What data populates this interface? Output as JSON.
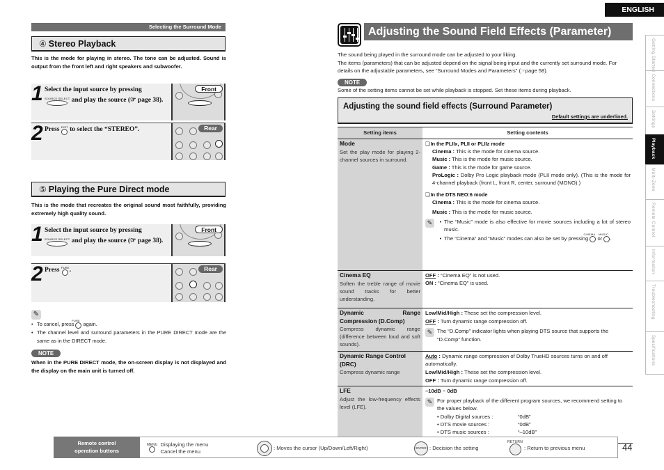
{
  "left_page": {
    "section_header": "Selecting the Surround Mode",
    "stereo": {
      "number": "④",
      "title": "Stereo Playback",
      "intro": "This is the mode for playing in stereo. The tone can be adjusted. Sound is output from the front left and right speakers and subwoofer.",
      "step1": {
        "num": "1",
        "text_a": "Select the input source by pressing",
        "button_label": "SOURCE SELECT",
        "text_b": "and play the source (",
        "page_ref_icon": "see-page-icon",
        "text_c": "page 38).",
        "tag": "Front"
      },
      "step2": {
        "num": "2",
        "text_a": "Press",
        "button_label": "D/ST",
        "text_b": "to select the “STEREO”.",
        "tag": "Rear"
      }
    },
    "pure_direct": {
      "number": "⑤",
      "title": "Playing the Pure Direct mode",
      "intro": "This is the mode that recreates the original sound most faithfully, providing extremely high quality sound.",
      "step1": {
        "num": "1",
        "text_a": "Select the input source by pressing",
        "button_label": "SOURCE SELECT",
        "text_b": "and play the source (",
        "text_c": "page 38).",
        "tag": "Front"
      },
      "step2": {
        "num": "2",
        "text_a": "Press",
        "button_label": "PURE",
        "text_b": ".",
        "tag": "Rear"
      },
      "tips": [
        {
          "text_a": "To cancel, press",
          "button_label": "PURE",
          "text_b": "again."
        },
        {
          "text": "The channel level and surround parameters in the PURE DIRECT mode are the same as in the DIRECT mode."
        }
      ],
      "note_label": "NOTE",
      "note_text": "When in the PURE DIRECT mode, the on-screen display is not displayed and the display on the main unit is turned off."
    }
  },
  "right_page": {
    "language": "ENGLISH",
    "title": "Adjusting the Sound Field Effects (Parameter)",
    "intro_lines": [
      "The sound being played in the surround mode can be adjusted to your liking.",
      "The items (parameters) that can be adjusted depend on the signal being input and the currently set surround mode. For details on the adjustable parameters, see “Surround Modes and Parameters” (",
      "page 58)."
    ],
    "note_label": "NOTE",
    "note_text": "Some of the setting items cannot be set while playback is stopped. Set these items during playback.",
    "subsection_title": "Adjusting the sound field effects (Surround Parameter)",
    "default_note": "Default settings are underlined.",
    "table": {
      "headers": [
        "Setting items",
        "Setting contents"
      ],
      "rows": [
        {
          "name": "Mode",
          "desc": "Set the play mode for playing 2-channel sources in surround.",
          "groups": [
            {
              "heading": "In the PLIIx, PLII or PLIIz mode",
              "options": [
                {
                  "label": "Cinema :",
                  "text": "This is the mode for cinema source."
                },
                {
                  "label": "Music :",
                  "text": "This is the mode for music source."
                },
                {
                  "label": "Game :",
                  "text": "This is the mode for game source."
                },
                {
                  "label": "ProLogic :",
                  "text": "Dolby Pro Logic playback mode (PLII mode only). (This is the mode for 4-channel playback (front L, front R, center, surround (MONO).)"
                }
              ]
            },
            {
              "heading": "In the DTS NEO:6 mode",
              "options": [
                {
                  "label": "Cinema :",
                  "text": "This is the mode for cinema source."
                },
                {
                  "label": "Music :",
                  "text": "This is the mode for music source."
                }
              ]
            }
          ],
          "tips": [
            "The “Music” mode is also effective for movie sources including a lot of stereo music.",
            "The “Cinema” and “Music” modes can also be set by pressing"
          ],
          "tip_buttons": [
            "CINEMA",
            "MUSIC"
          ],
          "tip_or": "or"
        },
        {
          "name": "Cinema EQ",
          "desc": "Soften the treble range of movie sound tracks for better understanding.",
          "options": [
            {
              "label": "OFF",
              "default": true,
              "text": "“Cinema EQ” is not used."
            },
            {
              "label": "ON",
              "default": false,
              "text": "“Cinema EQ” is used."
            }
          ]
        },
        {
          "name": "Dynamic Range Compression (D.Comp)",
          "desc": "Compress dynamic range (difference between loud and soft sounds).",
          "options": [
            {
              "label": "Low/Mid/High",
              "default": false,
              "text": "These set the compression level."
            },
            {
              "label": "OFF",
              "default": true,
              "text": "Turn dynamic range compression off."
            }
          ],
          "tip": "The “D.Comp” indicator lights when playing DTS source that supports the “D.Comp” function."
        },
        {
          "name": "Dynamic Range Control (DRC)",
          "desc": "Compress dynamic range",
          "options": [
            {
              "label": "Auto",
              "default": true,
              "text": "Dynamic range compression of Dolby TrueHD sources turns on and off automatically."
            },
            {
              "label": "Low/Mid/High",
              "default": false,
              "text": "These set the compression level."
            },
            {
              "label": "OFF",
              "default": false,
              "text": "Turn dynamic range compression off."
            }
          ]
        },
        {
          "name": "LFE",
          "desc": "Adjust the low-frequency effects level (LFE).",
          "range": "–10dB ~ 0dB",
          "tip": "For proper playback of the different program sources, we recommend setting to the values below.",
          "recommendations": [
            {
              "source": "Dolby Digital sources :",
              "value": "“0dB”"
            },
            {
              "source": "DTS movie sources :",
              "value": "“0dB”"
            },
            {
              "source": "DTS music sources :",
              "value": "“–10dB”"
            }
          ]
        }
      ]
    },
    "side_tabs": [
      {
        "label": "Getting Started",
        "active": false
      },
      {
        "label": "Connections",
        "active": false
      },
      {
        "label": "Settings",
        "active": false
      },
      {
        "label": "Playback",
        "active": true
      },
      {
        "label": "Multi-Zone",
        "active": false
      },
      {
        "label": "Remote Control",
        "active": false
      },
      {
        "label": "Information",
        "active": false
      },
      {
        "label": "Troubleshooting",
        "active": false
      },
      {
        "label": "Specifications",
        "active": false
      }
    ]
  },
  "bottom_bar": {
    "label_line1": "Remote control",
    "label_line2": "operation buttons",
    "menu_button": "MENU",
    "menu_line1": "Displaying the menu",
    "menu_line2": "Cancel the menu",
    "cursor_text": ": Moves the cursor (Up/Down/Left/Right)",
    "enter_button": "ENTER",
    "enter_text": ": Decision the setting",
    "return_button": "RETURN",
    "return_text": ": Return to previous menu"
  },
  "page_number": "44"
}
